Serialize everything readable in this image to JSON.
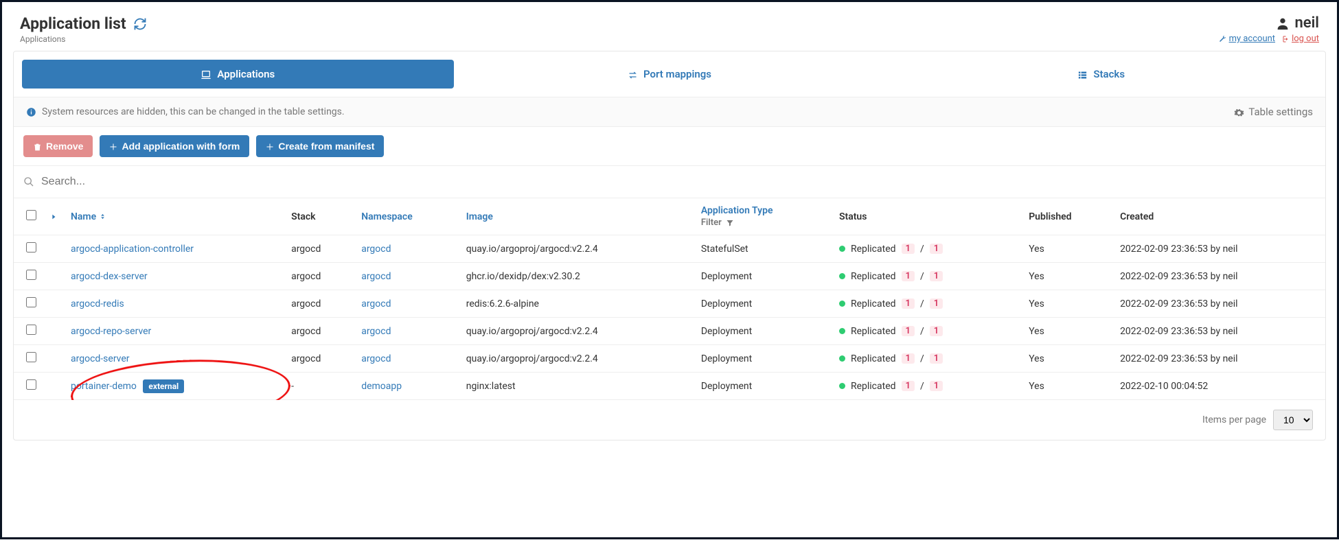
{
  "header": {
    "title": "Application list",
    "breadcrumb": "Applications",
    "username": "neil",
    "my_account": "my account",
    "log_out": "log out"
  },
  "tabs": {
    "applications": "Applications",
    "port_mappings": "Port mappings",
    "stacks": "Stacks"
  },
  "info": {
    "message": "System resources are hidden, this can be changed in the table settings.",
    "table_settings": "Table settings"
  },
  "actions": {
    "remove": "Remove",
    "add_form": "Add application with form",
    "create_manifest": "Create from manifest"
  },
  "search": {
    "placeholder": "Search..."
  },
  "columns": {
    "name": "Name",
    "stack": "Stack",
    "namespace": "Namespace",
    "image": "Image",
    "app_type": "Application Type",
    "filter": "Filter",
    "status": "Status",
    "published": "Published",
    "created": "Created"
  },
  "rows": [
    {
      "name": "argocd-application-controller",
      "stack": "argocd",
      "namespace": "argocd",
      "image": "quay.io/argoproj/argocd:v2.2.4",
      "type": "StatefulSet",
      "status": "Replicated",
      "r1": "1",
      "r2": "1",
      "published": "Yes",
      "created": "2022-02-09 23:36:53 by neil",
      "external": false
    },
    {
      "name": "argocd-dex-server",
      "stack": "argocd",
      "namespace": "argocd",
      "image": "ghcr.io/dexidp/dex:v2.30.2",
      "type": "Deployment",
      "status": "Replicated",
      "r1": "1",
      "r2": "1",
      "published": "Yes",
      "created": "2022-02-09 23:36:53 by neil",
      "external": false
    },
    {
      "name": "argocd-redis",
      "stack": "argocd",
      "namespace": "argocd",
      "image": "redis:6.2.6-alpine",
      "type": "Deployment",
      "status": "Replicated",
      "r1": "1",
      "r2": "1",
      "published": "Yes",
      "created": "2022-02-09 23:36:53 by neil",
      "external": false
    },
    {
      "name": "argocd-repo-server",
      "stack": "argocd",
      "namespace": "argocd",
      "image": "quay.io/argoproj/argocd:v2.2.4",
      "type": "Deployment",
      "status": "Replicated",
      "r1": "1",
      "r2": "1",
      "published": "Yes",
      "created": "2022-02-09 23:36:53 by neil",
      "external": false
    },
    {
      "name": "argocd-server",
      "stack": "argocd",
      "namespace": "argocd",
      "image": "quay.io/argoproj/argocd:v2.2.4",
      "type": "Deployment",
      "status": "Replicated",
      "r1": "1",
      "r2": "1",
      "published": "Yes",
      "created": "2022-02-09 23:36:53 by neil",
      "external": false
    },
    {
      "name": "portainer-demo",
      "stack": "-",
      "namespace": "demoapp",
      "image": "nginx:latest",
      "type": "Deployment",
      "status": "Replicated",
      "r1": "1",
      "r2": "1",
      "published": "Yes",
      "created": "2022-02-10 00:04:52",
      "external": true
    }
  ],
  "badges": {
    "external": "external"
  },
  "pagination": {
    "label": "Items per page",
    "value": "10"
  }
}
